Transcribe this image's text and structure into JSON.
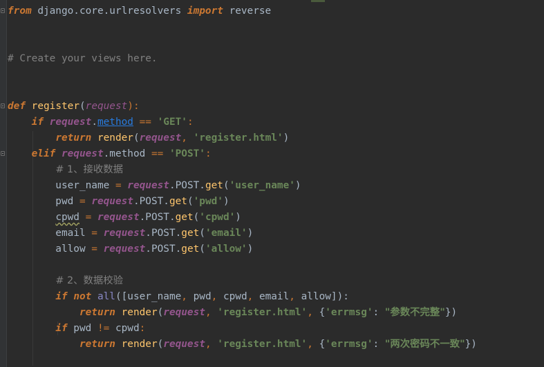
{
  "editor": {
    "lines": [
      {
        "tokens": [
          {
            "t": "from",
            "c": "kw"
          },
          {
            "t": " django.core.urlresolvers ",
            "c": ""
          },
          {
            "t": "import",
            "c": "kw"
          },
          {
            "t": " reverse",
            "c": ""
          }
        ]
      },
      {
        "tokens": []
      },
      {
        "tokens": []
      },
      {
        "tokens": [
          {
            "t": "# Create your views here.",
            "c": "comment"
          }
        ]
      },
      {
        "tokens": []
      },
      {
        "tokens": []
      },
      {
        "tokens": [
          {
            "t": "def",
            "c": "kw"
          },
          {
            "t": " ",
            "c": ""
          },
          {
            "t": "register",
            "c": "fn"
          },
          {
            "t": "(",
            "c": ""
          },
          {
            "t": "request",
            "c": "param"
          },
          {
            "t": "):",
            "c": "kw-plain"
          }
        ]
      },
      {
        "tokens": [
          {
            "t": "    ",
            "c": ""
          },
          {
            "t": "if",
            "c": "kw"
          },
          {
            "t": " ",
            "c": ""
          },
          {
            "t": "request",
            "c": "self"
          },
          {
            "t": ".",
            "c": ""
          },
          {
            "t": "method",
            "c": "attr-link"
          },
          {
            "t": " == ",
            "c": "kw-plain"
          },
          {
            "t": "'GET'",
            "c": "str"
          },
          {
            "t": ":",
            "c": "kw-plain"
          }
        ]
      },
      {
        "tokens": [
          {
            "t": "        ",
            "c": ""
          },
          {
            "t": "return",
            "c": "kw"
          },
          {
            "t": " ",
            "c": ""
          },
          {
            "t": "render",
            "c": "meth"
          },
          {
            "t": "(",
            "c": ""
          },
          {
            "t": "request",
            "c": "self"
          },
          {
            "t": ", ",
            "c": "kw-plain"
          },
          {
            "t": "'register.html'",
            "c": "str"
          },
          {
            "t": ")",
            "c": ""
          }
        ]
      },
      {
        "tokens": [
          {
            "t": "    ",
            "c": ""
          },
          {
            "t": "elif",
            "c": "kw"
          },
          {
            "t": " ",
            "c": ""
          },
          {
            "t": "request",
            "c": "self"
          },
          {
            "t": ".method ",
            "c": ""
          },
          {
            "t": "==",
            "c": "kw-plain"
          },
          {
            "t": " ",
            "c": ""
          },
          {
            "t": "'POST'",
            "c": "str"
          },
          {
            "t": ":",
            "c": "kw-plain"
          }
        ]
      },
      {
        "tokens": [
          {
            "t": "        ",
            "c": ""
          },
          {
            "t": "# 1、接收数据",
            "c": "comment-cjk"
          }
        ]
      },
      {
        "tokens": [
          {
            "t": "        user_name ",
            "c": ""
          },
          {
            "t": "=",
            "c": "kw-plain"
          },
          {
            "t": " ",
            "c": ""
          },
          {
            "t": "request",
            "c": "self"
          },
          {
            "t": ".POST.",
            "c": ""
          },
          {
            "t": "get",
            "c": "meth"
          },
          {
            "t": "(",
            "c": ""
          },
          {
            "t": "'user_name'",
            "c": "str"
          },
          {
            "t": ")",
            "c": ""
          }
        ]
      },
      {
        "tokens": [
          {
            "t": "        pwd ",
            "c": ""
          },
          {
            "t": "=",
            "c": "kw-plain"
          },
          {
            "t": " ",
            "c": ""
          },
          {
            "t": "request",
            "c": "self"
          },
          {
            "t": ".POST.",
            "c": ""
          },
          {
            "t": "get",
            "c": "meth"
          },
          {
            "t": "(",
            "c": ""
          },
          {
            "t": "'pwd'",
            "c": "str"
          },
          {
            "t": ")",
            "c": ""
          }
        ]
      },
      {
        "tokens": [
          {
            "t": "        ",
            "c": ""
          },
          {
            "t": "cpwd",
            "c": "squiggle"
          },
          {
            "t": " ",
            "c": ""
          },
          {
            "t": "=",
            "c": "kw-plain"
          },
          {
            "t": " ",
            "c": ""
          },
          {
            "t": "request",
            "c": "self"
          },
          {
            "t": ".POST.",
            "c": ""
          },
          {
            "t": "get",
            "c": "meth"
          },
          {
            "t": "(",
            "c": ""
          },
          {
            "t": "'cpwd'",
            "c": "str"
          },
          {
            "t": ")",
            "c": ""
          }
        ]
      },
      {
        "tokens": [
          {
            "t": "        email ",
            "c": ""
          },
          {
            "t": "=",
            "c": "kw-plain"
          },
          {
            "t": " ",
            "c": ""
          },
          {
            "t": "request",
            "c": "self"
          },
          {
            "t": ".POST.",
            "c": ""
          },
          {
            "t": "get",
            "c": "meth"
          },
          {
            "t": "(",
            "c": ""
          },
          {
            "t": "'email'",
            "c": "str"
          },
          {
            "t": ")",
            "c": ""
          }
        ]
      },
      {
        "tokens": [
          {
            "t": "        allow ",
            "c": ""
          },
          {
            "t": "=",
            "c": "kw-plain"
          },
          {
            "t": " ",
            "c": ""
          },
          {
            "t": "request",
            "c": "self"
          },
          {
            "t": ".POST.",
            "c": ""
          },
          {
            "t": "get",
            "c": "meth"
          },
          {
            "t": "(",
            "c": ""
          },
          {
            "t": "'allow'",
            "c": "str"
          },
          {
            "t": ")",
            "c": ""
          }
        ]
      },
      {
        "tokens": []
      },
      {
        "tokens": [
          {
            "t": "        ",
            "c": ""
          },
          {
            "t": "# 2、数据校验",
            "c": "comment-cjk"
          }
        ]
      },
      {
        "tokens": [
          {
            "t": "        ",
            "c": ""
          },
          {
            "t": "if",
            "c": "kw"
          },
          {
            "t": " ",
            "c": ""
          },
          {
            "t": "not",
            "c": "kw"
          },
          {
            "t": " ",
            "c": ""
          },
          {
            "t": "all",
            "c": "builtin"
          },
          {
            "t": "([user_name",
            "c": ""
          },
          {
            "t": ", ",
            "c": "kw-plain"
          },
          {
            "t": "pwd",
            "c": ""
          },
          {
            "t": ", ",
            "c": "kw-plain"
          },
          {
            "t": "cpwd",
            "c": ""
          },
          {
            "t": ", ",
            "c": "kw-plain"
          },
          {
            "t": "email",
            "c": ""
          },
          {
            "t": ", ",
            "c": "kw-plain"
          },
          {
            "t": "allow]):",
            "c": ""
          }
        ]
      },
      {
        "tokens": [
          {
            "t": "            ",
            "c": ""
          },
          {
            "t": "return",
            "c": "kw"
          },
          {
            "t": " ",
            "c": ""
          },
          {
            "t": "render",
            "c": "meth"
          },
          {
            "t": "(",
            "c": ""
          },
          {
            "t": "request",
            "c": "self"
          },
          {
            "t": ", ",
            "c": "kw-plain"
          },
          {
            "t": "'register.html'",
            "c": "str"
          },
          {
            "t": ", ",
            "c": "kw-plain"
          },
          {
            "t": "{",
            "c": ""
          },
          {
            "t": "'errmsg'",
            "c": "str"
          },
          {
            "t": ": ",
            "c": ""
          },
          {
            "t": "\"参数不完整\"",
            "c": "cjk-str"
          },
          {
            "t": "})",
            "c": ""
          }
        ]
      },
      {
        "tokens": [
          {
            "t": "        ",
            "c": ""
          },
          {
            "t": "if",
            "c": "kw"
          },
          {
            "t": " pwd ",
            "c": ""
          },
          {
            "t": "!=",
            "c": "kw-plain"
          },
          {
            "t": " cpwd",
            "c": ""
          },
          {
            "t": ":",
            "c": "kw-plain"
          }
        ]
      },
      {
        "tokens": [
          {
            "t": "            ",
            "c": ""
          },
          {
            "t": "return",
            "c": "kw"
          },
          {
            "t": " ",
            "c": ""
          },
          {
            "t": "render",
            "c": "meth"
          },
          {
            "t": "(",
            "c": ""
          },
          {
            "t": "request",
            "c": "self"
          },
          {
            "t": ", ",
            "c": "kw-plain"
          },
          {
            "t": "'register.html'",
            "c": "str"
          },
          {
            "t": ", ",
            "c": "kw-plain"
          },
          {
            "t": "{",
            "c": ""
          },
          {
            "t": "'errmsg'",
            "c": "str"
          },
          {
            "t": ": ",
            "c": ""
          },
          {
            "t": "\"两次密码不一致\"",
            "c": "cjk-str"
          },
          {
            "t": "})",
            "c": ""
          }
        ]
      }
    ]
  }
}
